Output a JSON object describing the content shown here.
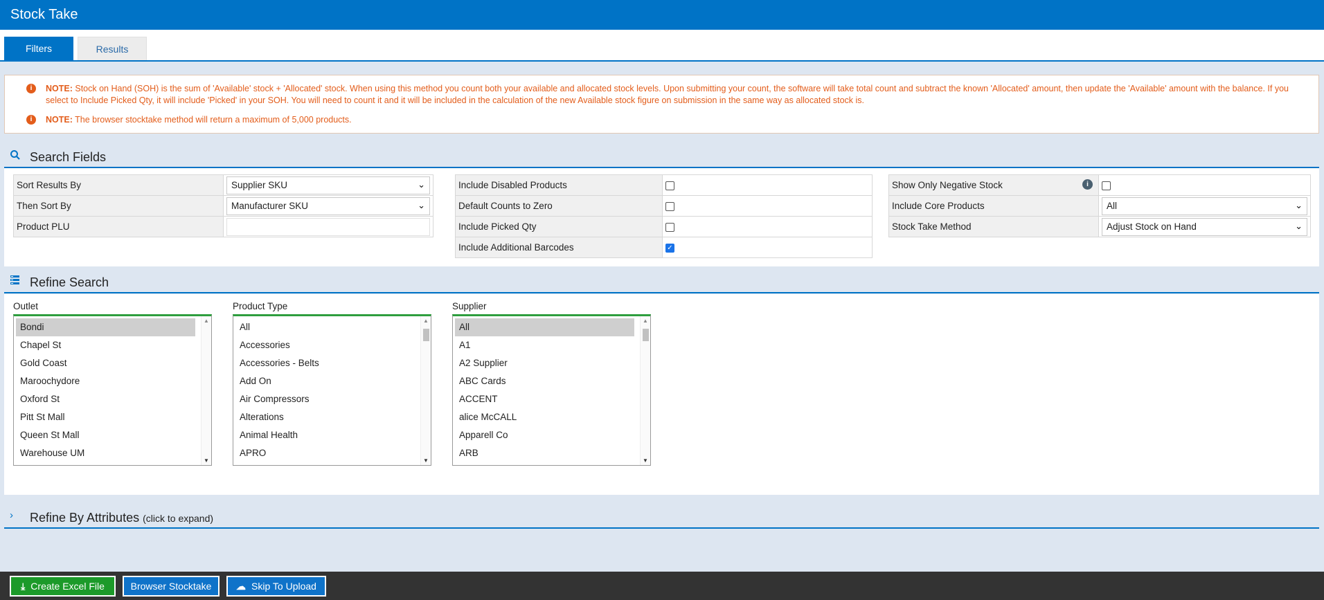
{
  "window": {
    "title": "Stock Take"
  },
  "tabs": [
    {
      "label": "Filters",
      "active": true
    },
    {
      "label": "Results",
      "active": false
    }
  ],
  "notes": [
    {
      "label": "NOTE:",
      "text": "Stock on Hand (SOH) is the sum of 'Available' stock + 'Allocated' stock. When using this method you count both your available and allocated stock levels. Upon submitting your count, the software will take total count and subtract the known 'Allocated' amount, then update the 'Available' amount with the balance. If you select to Include Picked Qty, it will include 'Picked' in your SOH. You will need to count it and it will be included in the calculation of the new Available stock figure on submission in the same way as allocated stock is."
    },
    {
      "label": "NOTE:",
      "text": "The browser stocktake method will return a maximum of 5,000 products."
    }
  ],
  "search_fields": {
    "title": "Search Fields",
    "sort_results_by": {
      "label": "Sort Results By",
      "value": "Supplier SKU"
    },
    "then_sort_by": {
      "label": "Then Sort By",
      "value": "Manufacturer SKU"
    },
    "product_plu": {
      "label": "Product PLU",
      "value": ""
    },
    "include_disabled": {
      "label": "Include Disabled Products",
      "checked": false
    },
    "default_counts_zero": {
      "label": "Default Counts to Zero",
      "checked": false
    },
    "include_picked": {
      "label": "Include Picked Qty",
      "checked": false
    },
    "include_barcodes": {
      "label": "Include Additional Barcodes",
      "checked": true
    },
    "show_negative": {
      "label": "Show Only Negative Stock",
      "checked": false
    },
    "include_core": {
      "label": "Include Core Products",
      "value": "All"
    },
    "stock_take_method": {
      "label": "Stock Take Method",
      "value": "Adjust Stock on Hand"
    }
  },
  "refine_search": {
    "title": "Refine Search",
    "outlet": {
      "label": "Outlet",
      "items": [
        "Bondi",
        "Chapel St",
        "Gold Coast",
        "Maroochydore",
        "Oxford St",
        "Pitt St Mall",
        "Queen St Mall",
        "Warehouse UM"
      ],
      "selected": "Bondi"
    },
    "product_type": {
      "label": "Product Type",
      "items": [
        "All",
        "Accessories",
        "Accessories - Belts",
        "Add On",
        "Air Compressors",
        "Alterations",
        "Animal Health",
        "APRO"
      ],
      "selected": ""
    },
    "supplier": {
      "label": "Supplier",
      "items": [
        "All",
        "A1",
        "A2 Supplier",
        "ABC Cards",
        "ACCENT",
        "alice McCALL",
        "Apparell Co",
        "ARB"
      ],
      "selected": "All"
    }
  },
  "refine_attributes": {
    "title": "Refine By Attributes",
    "hint": "(click to expand)"
  },
  "actions": {
    "create_excel": "Create Excel File",
    "browser_stocktake": "Browser Stocktake",
    "skip_upload": "Skip To Upload"
  },
  "colors": {
    "primary": "#0073c6",
    "note": "#e35d1b",
    "excel_button": "#1c9a2a",
    "list_border": "#2e9e3e"
  }
}
